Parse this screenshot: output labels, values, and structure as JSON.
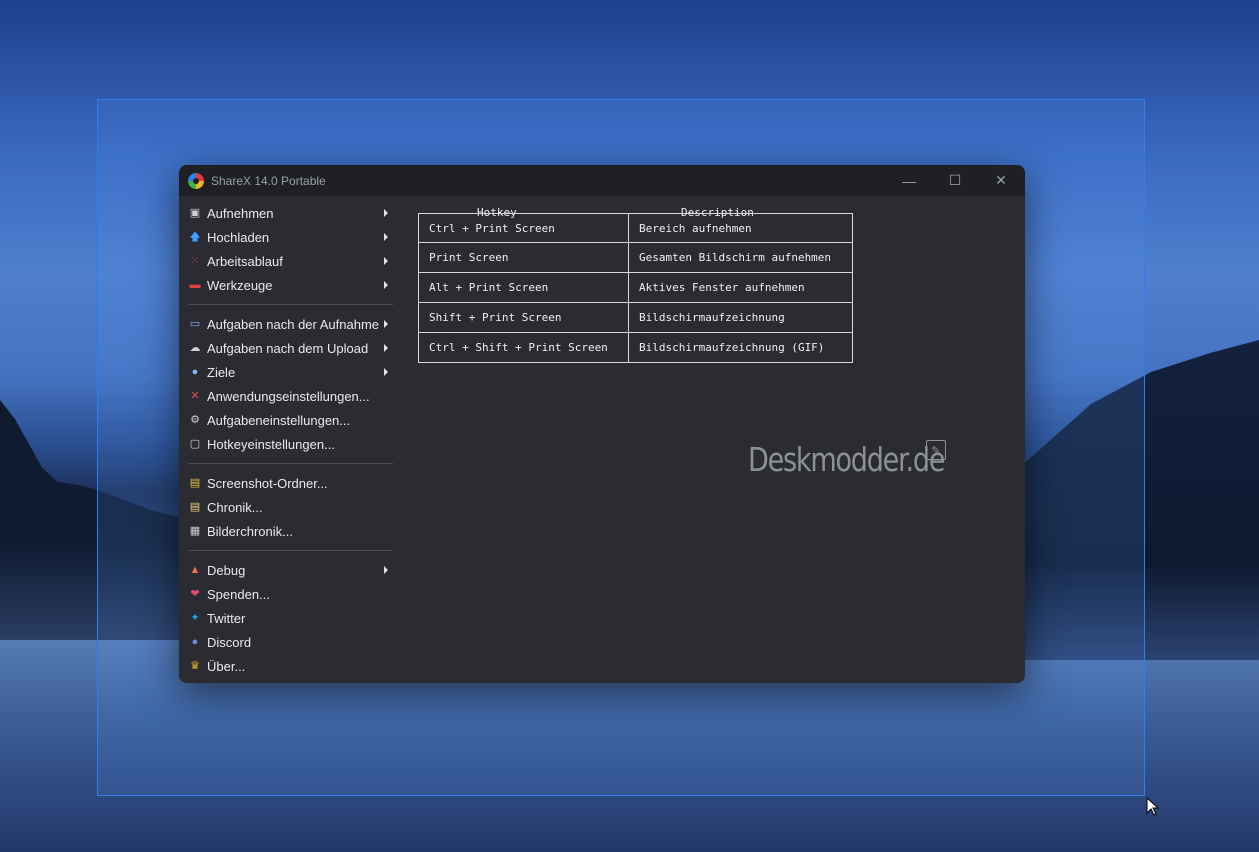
{
  "window": {
    "title": "ShareX 14.0 Portable",
    "minimize_glyph": "—",
    "maximize_glyph": "☐",
    "close_glyph": "✕"
  },
  "menu": {
    "groups": [
      [
        {
          "label": "Aufnehmen",
          "icon": "camera-icon",
          "submenu": true
        },
        {
          "label": "Hochladen",
          "icon": "upload-arrow-icon",
          "submenu": true
        },
        {
          "label": "Arbeitsablauf",
          "icon": "grid-dots-icon",
          "submenu": true
        },
        {
          "label": "Werkzeuge",
          "icon": "toolbox-icon",
          "submenu": true
        }
      ],
      [
        {
          "label": "Aufgaben nach der Aufnahme",
          "icon": "image-task-icon",
          "submenu": true
        },
        {
          "label": "Aufgaben nach dem Upload",
          "icon": "cloud-upload-icon",
          "submenu": true
        },
        {
          "label": "Ziele",
          "icon": "target-user-icon",
          "submenu": true
        },
        {
          "label": "Anwendungseinstellungen...",
          "icon": "tools-icon",
          "submenu": false
        },
        {
          "label": "Aufgabeneinstellungen...",
          "icon": "gear-icon",
          "submenu": false
        },
        {
          "label": "Hotkeyeinstellungen...",
          "icon": "keyboard-key-icon",
          "submenu": false
        }
      ],
      [
        {
          "label": "Screenshot-Ordner...",
          "icon": "folder-icon",
          "submenu": false
        },
        {
          "label": "Chronik...",
          "icon": "history-icon",
          "submenu": false
        },
        {
          "label": "Bilderchronik...",
          "icon": "image-history-icon",
          "submenu": false
        }
      ],
      [
        {
          "label": "Debug",
          "icon": "traffic-cone-icon",
          "submenu": true
        },
        {
          "label": "Spenden...",
          "icon": "heart-icon",
          "submenu": false
        },
        {
          "label": "Twitter",
          "icon": "twitter-bird-icon",
          "submenu": false
        },
        {
          "label": "Discord",
          "icon": "discord-icon",
          "submenu": false
        },
        {
          "label": "Über...",
          "icon": "crown-icon",
          "submenu": false
        }
      ]
    ]
  },
  "hotkeys": {
    "header_hotkey": "Hotkey",
    "header_description": "Description",
    "rows": [
      {
        "hotkey": "Ctrl + Print Screen",
        "description": "Bereich aufnehmen"
      },
      {
        "hotkey": "Print Screen",
        "description": "Gesamten Bildschirm aufnehmen"
      },
      {
        "hotkey": "Alt + Print Screen",
        "description": "Aktives Fenster aufnehmen"
      },
      {
        "hotkey": "Shift + Print Screen",
        "description": "Bildschirmaufzeichnung"
      },
      {
        "hotkey": "Ctrl + Shift + Print Screen",
        "description": "Bildschirmaufzeichnung (GIF)"
      }
    ]
  },
  "watermark": {
    "text": "Deskmodder.de"
  },
  "colors": {
    "selection_border": "#2d7ff0",
    "window_bg": "#2a2c31",
    "titlebar_bg": "#1f2024"
  }
}
